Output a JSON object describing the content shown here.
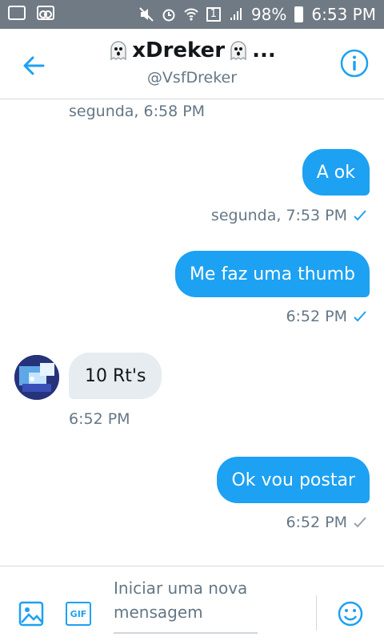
{
  "status_bar": {
    "battery": "98%",
    "sim": "1",
    "time": "6:53 PM"
  },
  "header": {
    "title": "xDreker",
    "ellipsis": "...",
    "handle": "@VsfDreker"
  },
  "messages": {
    "ts_first": "segunda, 6:58 PM",
    "m1_text": "A ok",
    "m1_time": "segunda, 7:53 PM",
    "m2_text": "Me faz uma thumb",
    "m2_time": "6:52 PM",
    "m3_text": "10 Rt's",
    "m3_time": "6:52 PM",
    "m4_text": "Ok vou postar",
    "m4_time": "6:52 PM"
  },
  "composer": {
    "placeholder": "Iniciar uma nova mensagem",
    "gif_label": "GIF"
  },
  "colors": {
    "accent": "#1da1f2",
    "status_bar": "#707a84",
    "incoming_bubble": "#e6ecf0",
    "muted_text": "#657786"
  },
  "icons": [
    "back-arrow-icon",
    "info-icon",
    "ghost-emoji-icon",
    "check-icon",
    "image-icon",
    "gif-icon",
    "emoji-icon"
  ]
}
